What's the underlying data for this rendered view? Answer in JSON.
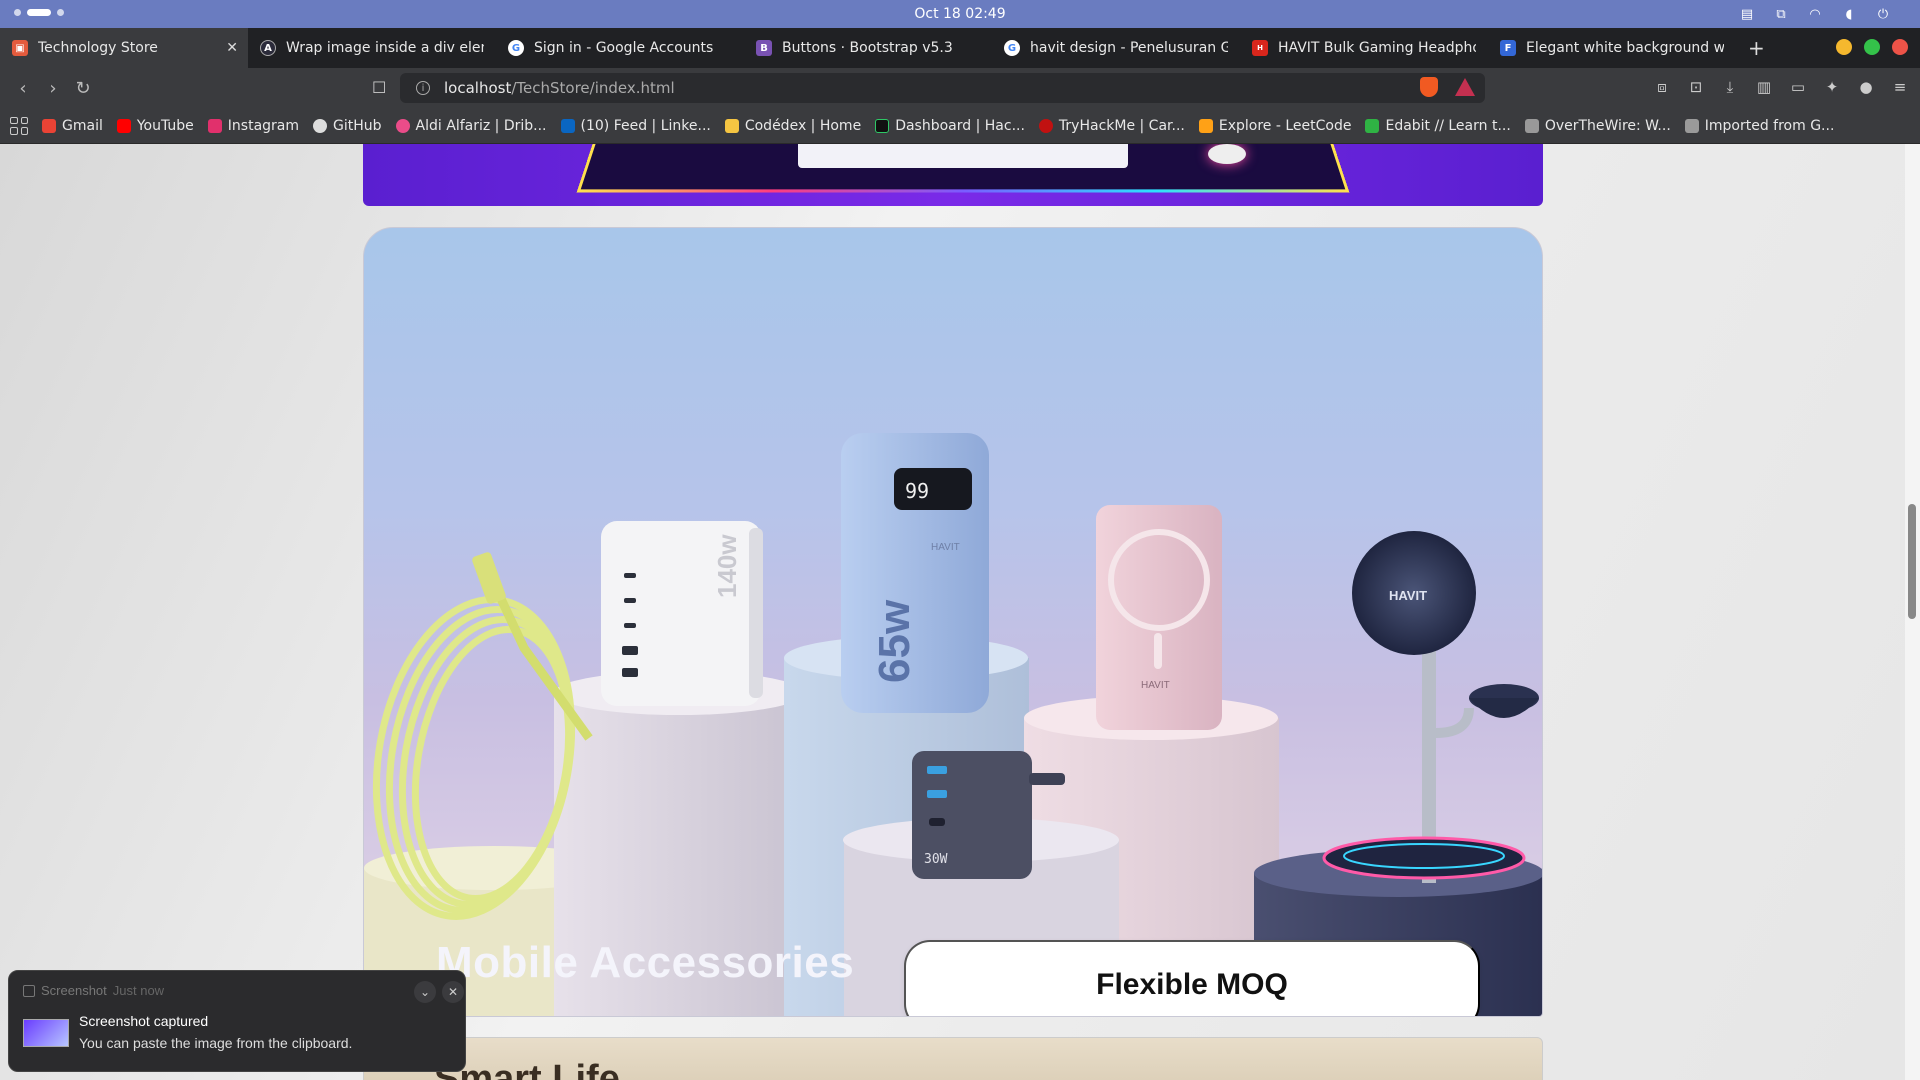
{
  "system": {
    "clock": "Oct 18  02:49"
  },
  "tabs": [
    {
      "label": "Technology Store",
      "favicon_color": "#e45b3d",
      "active": true
    },
    {
      "label": "Wrap image inside a div elemen",
      "favicon_color": "#2b2b3a",
      "active": false
    },
    {
      "label": "Sign in - Google Accounts",
      "favicon_color": "#4285f4",
      "active": false
    },
    {
      "label": "Buttons · Bootstrap v5.3",
      "favicon_color": "#7952b3",
      "active": false
    },
    {
      "label": "havit design - Penelusuran Goog",
      "favicon_color": "#4285f4",
      "active": false
    },
    {
      "label": "HAVIT Bulk Gaming Headphone",
      "favicon_color": "#d9261c",
      "active": false
    },
    {
      "label": "Elegant white background with",
      "favicon_color": "#3367d6",
      "active": false
    }
  ],
  "address": {
    "host": "localhost",
    "path": "/TechStore/index.html"
  },
  "bookmarks": [
    {
      "label": "Gmail",
      "color": "#ea4335"
    },
    {
      "label": "YouTube",
      "color": "#ff0000"
    },
    {
      "label": "Instagram",
      "color": "#e1306c"
    },
    {
      "label": "GitHub",
      "color": "#dddddd"
    },
    {
      "label": "Aldi Alfariz | Drib...",
      "color": "#ea4c89"
    },
    {
      "label": "(10) Feed | Linke...",
      "color": "#0a66c2"
    },
    {
      "label": "Codédex | Home",
      "color": "#f5c542"
    },
    {
      "label": "Dashboard | Hac...",
      "color": "#111111"
    },
    {
      "label": "TryHackMe | Car...",
      "color": "#c11111"
    },
    {
      "label": "Explore - LeetCode",
      "color": "#ffa116"
    },
    {
      "label": "Edabit // Learn t...",
      "color": "#2fb344"
    },
    {
      "label": "OverTheWire: W...",
      "color": "#999999"
    },
    {
      "label": "Imported from G...",
      "color": "#9a9a9a"
    }
  ],
  "page": {
    "card_title": "Mobile Accessories",
    "moq_button": "Flexible MOQ",
    "next_card_title": "Smart Life",
    "brand_text": "HAVIT",
    "powerbank_display": "99",
    "powerbank_capacity": "65w",
    "charger_rating": "140w",
    "charger_power": "30W"
  },
  "notification": {
    "app": "Screenshot",
    "when": "Just now",
    "title": "Screenshot captured",
    "body": "You can paste the image from the clipboard."
  },
  "colors": {
    "topbar": "#6a7cc0",
    "card_sky": "#a8c6ea",
    "banner_purple": "#6a24df"
  }
}
